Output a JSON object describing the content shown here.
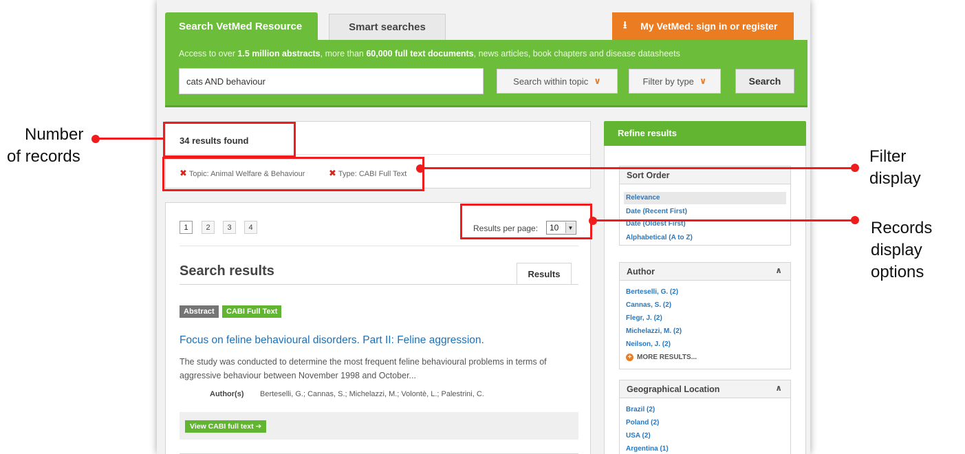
{
  "tabs": {
    "search": "Search VetMed Resource",
    "smart": "Smart searches",
    "myvetmed": "My VetMed: sign in or register"
  },
  "search_band": {
    "access_prefix": "Access to over ",
    "access_bold1": "1.5 million abstracts",
    "access_mid": ", more than ",
    "access_bold2": "60,000 full text documents",
    "access_suffix": ", news articles, book chapters and disease datasheets",
    "query": "cats AND behaviour",
    "topic_dropdown": "Search within topic",
    "type_dropdown": "Filter by type",
    "search_button": "Search"
  },
  "summary": {
    "count": "34 results found",
    "filters": [
      "Topic: Animal Welfare & Behaviour",
      "Type: CABI Full Text"
    ]
  },
  "pagination": {
    "pages": [
      "1",
      "2",
      "3",
      "4"
    ],
    "current_page": "1",
    "rpp_label": "Results per page:",
    "rpp_value": "10"
  },
  "results": {
    "heading": "Search results",
    "tab": "Results",
    "items": [
      {
        "badges": [
          "Abstract",
          "CABI Full Text"
        ],
        "title": "Focus on feline behavioural disorders. Part II: Feline aggression.",
        "snippet": "The study was conducted to determine the most frequent feline behavioural problems in terms of aggressive behaviour between November 1998 and October...",
        "authors_label": "Author(s)",
        "authors": "Berteselli, G.; Cannas, S.; Michelazzi, M.; Volontè, L.; Palestrini, C.",
        "fulltext_button": "View CABI full text ➔"
      }
    ]
  },
  "refine": {
    "heading": "Refine results",
    "sort": {
      "title": "Sort Order",
      "options": [
        "Relevance",
        "Date (Recent First)",
        "Date (Oldest First)",
        "Alphabetical (A to Z)"
      ],
      "selected": "Relevance"
    },
    "author": {
      "title": "Author",
      "items": [
        "Berteselli, G. (2)",
        "Cannas, S. (2)",
        "Flegr, J. (2)",
        "Michelazzi, M. (2)",
        "Neilson, J. (2)"
      ],
      "more": "MORE RESULTS..."
    },
    "geo": {
      "title": "Geographical Location",
      "items": [
        "Brazil (2)",
        "Poland (2)",
        "USA (2)",
        "Argentina (1)"
      ]
    }
  },
  "callouts": {
    "records_line1": "Number",
    "records_line2": "of records",
    "filter_line1": "Filter",
    "filter_line2": "display",
    "options_line1": "Records",
    "options_line2": "display",
    "options_line3": "options"
  },
  "colors": {
    "brand_green": "#6cbd3a",
    "brand_orange": "#ec7c22",
    "link_blue": "#1b71b9",
    "callout_red": "#ee1c1c"
  }
}
